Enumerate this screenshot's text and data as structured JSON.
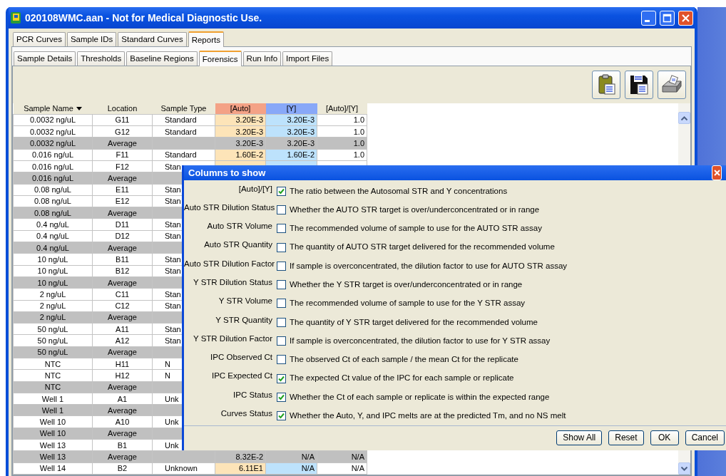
{
  "window": {
    "title": "020108WMC.aan - Not for Medical Diagnostic Use."
  },
  "tabs": [
    {
      "label": "PCR Curves",
      "selected": false
    },
    {
      "label": "Sample IDs",
      "selected": false
    },
    {
      "label": "Standard Curves",
      "selected": false
    },
    {
      "label": "Reports",
      "selected": true
    }
  ],
  "subtabs": [
    {
      "label": "Sample Details",
      "selected": false
    },
    {
      "label": "Thresholds",
      "selected": false
    },
    {
      "label": "Baseline Regions",
      "selected": false
    },
    {
      "label": "Forensics",
      "selected": true
    },
    {
      "label": "Run Info",
      "selected": false
    },
    {
      "label": "Import Files",
      "selected": false
    }
  ],
  "table": {
    "columns": [
      {
        "label": "Sample Name",
        "kind": "sorted"
      },
      {
        "label": "Location",
        "kind": "plain"
      },
      {
        "label": "Sample Type",
        "kind": "plain"
      },
      {
        "label": "[Auto]",
        "kind": "auto"
      },
      {
        "label": "[Y]",
        "kind": "y"
      },
      {
        "label": "[Auto]/[Y]",
        "kind": "plain"
      }
    ],
    "rows": [
      {
        "kind": "sample",
        "name": "0.0032 ng/uL",
        "location": "G11",
        "type": "Standard",
        "auto": "3.20E-3",
        "y": "3.20E-3",
        "ratio": "1.0"
      },
      {
        "kind": "sample",
        "name": "0.0032 ng/uL",
        "location": "G12",
        "type": "Standard",
        "auto": "3.20E-3",
        "y": "3.20E-3",
        "ratio": "1.0"
      },
      {
        "kind": "average",
        "name": "0.0032 ng/uL",
        "location": "Average",
        "auto": "3.20E-3",
        "y": "3.20E-3",
        "ratio": "1.0"
      },
      {
        "kind": "sample",
        "name": "0.016 ng/uL",
        "location": "F11",
        "type": "Standard",
        "auto": "1.60E-2",
        "y": "1.60E-2",
        "ratio": "1.0"
      },
      {
        "kind": "sample",
        "name": "0.016 ng/uL",
        "location": "F12",
        "type": "Stan"
      },
      {
        "kind": "average",
        "name": "0.016 ng/uL",
        "location": "Average"
      },
      {
        "kind": "sample",
        "name": "0.08 ng/uL",
        "location": "E11",
        "type": "Stan"
      },
      {
        "kind": "sample",
        "name": "0.08 ng/uL",
        "location": "E12",
        "type": "Stan"
      },
      {
        "kind": "average",
        "name": "0.08 ng/uL",
        "location": "Average"
      },
      {
        "kind": "sample",
        "name": "0.4 ng/uL",
        "location": "D11",
        "type": "Stan"
      },
      {
        "kind": "sample",
        "name": "0.4 ng/uL",
        "location": "D12",
        "type": "Stan"
      },
      {
        "kind": "average",
        "name": "0.4 ng/uL",
        "location": "Average"
      },
      {
        "kind": "sample",
        "name": "10 ng/uL",
        "location": "B11",
        "type": "Stan"
      },
      {
        "kind": "sample",
        "name": "10 ng/uL",
        "location": "B12",
        "type": "Stan"
      },
      {
        "kind": "average",
        "name": "10 ng/uL",
        "location": "Average"
      },
      {
        "kind": "sample",
        "name": "2 ng/uL",
        "location": "C11",
        "type": "Stan"
      },
      {
        "kind": "sample",
        "name": "2 ng/uL",
        "location": "C12",
        "type": "Stan"
      },
      {
        "kind": "average",
        "name": "2 ng/uL",
        "location": "Average"
      },
      {
        "kind": "sample",
        "name": "50 ng/uL",
        "location": "A11",
        "type": "Stan"
      },
      {
        "kind": "sample",
        "name": "50 ng/uL",
        "location": "A12",
        "type": "Stan"
      },
      {
        "kind": "average",
        "name": "50 ng/uL",
        "location": "Average"
      },
      {
        "kind": "sample",
        "name": "NTC",
        "location": "H11",
        "type": "N"
      },
      {
        "kind": "sample",
        "name": "NTC",
        "location": "H12",
        "type": "N"
      },
      {
        "kind": "average",
        "name": "NTC",
        "location": "Average"
      },
      {
        "kind": "sample",
        "name": "Well 1",
        "location": "A1",
        "type": "Unk"
      },
      {
        "kind": "average",
        "name": "Well 1",
        "location": "Average"
      },
      {
        "kind": "sample",
        "name": "Well 10",
        "location": "A10",
        "type": "Unk"
      },
      {
        "kind": "average",
        "name": "Well 10",
        "location": "Average"
      },
      {
        "kind": "sample",
        "name": "Well 13",
        "location": "B1",
        "type": "Unk"
      },
      {
        "kind": "average",
        "name": "Well 13",
        "location": "Average",
        "auto": "8.32E-2",
        "y": "N/A",
        "ratio": "N/A"
      },
      {
        "kind": "sample",
        "name": "Well 14",
        "location": "B2",
        "type": "Unknown",
        "auto": "6.11E1",
        "y": "N/A",
        "ratio": "N/A"
      }
    ]
  },
  "dialog": {
    "title": "Columns to show",
    "options": [
      {
        "label": "[Auto]/[Y]",
        "description": "The ratio between the Autosomal STR and Y concentrations",
        "checked": true
      },
      {
        "label": "Auto STR Dilution Status",
        "description": "Whether the AUTO STR target is over/underconcentrated or in range",
        "checked": false
      },
      {
        "label": "Auto STR Volume",
        "description": "The recommended volume of sample to use for the AUTO STR assay",
        "checked": false
      },
      {
        "label": "Auto STR Quantity",
        "description": "The quantity of AUTO STR target delivered for the recommended volume",
        "checked": false
      },
      {
        "label": "Auto STR Dilution Factor",
        "description": "If sample is overconcentrated, the dilution factor to use for AUTO STR assay",
        "checked": false
      },
      {
        "label": "Y STR Dilution Status",
        "description": "Whether the Y STR target is over/underconcentrated or in range",
        "checked": false
      },
      {
        "label": "Y STR Volume",
        "description": "The recommended volume of sample to use for the Y STR assay",
        "checked": false
      },
      {
        "label": "Y STR Quantity",
        "description": "The quantity of Y STR target delivered for the recommended volume",
        "checked": false
      },
      {
        "label": "Y STR Dilution Factor",
        "description": "If sample is overconcentrated, the dilution factor to use for Y STR assay",
        "checked": false
      },
      {
        "label": "IPC Observed Ct",
        "description": "The observed Ct of each sample / the mean Ct for the replicate",
        "checked": false
      },
      {
        "label": "IPC Expected Ct",
        "description": "The expected Ct value of the IPC for each sample or replicate",
        "checked": true
      },
      {
        "label": "IPC Status",
        "description": "Whether the Ct of each sample or replicate is within the expected range",
        "checked": true
      },
      {
        "label": "Curves Status",
        "description": "Whether the Auto, Y, and IPC melts are at the predicted Tm, and no NS melt",
        "checked": true
      }
    ],
    "buttons": [
      "Show All",
      "Reset",
      "OK",
      "Cancel"
    ]
  }
}
